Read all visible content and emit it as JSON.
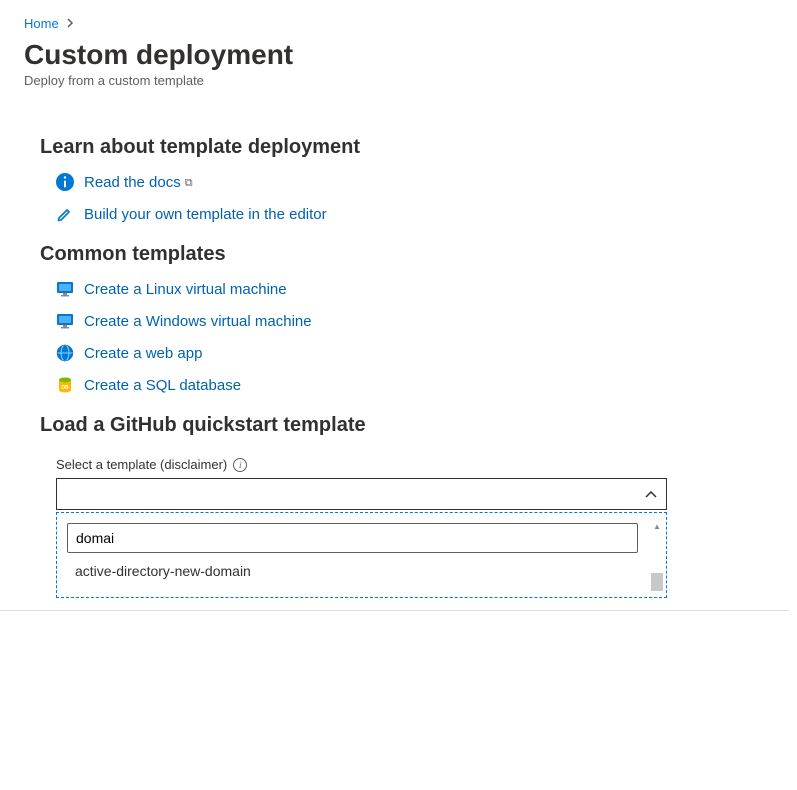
{
  "breadcrumb": {
    "home": "Home"
  },
  "header": {
    "title": "Custom deployment",
    "subtitle": "Deploy from a custom template"
  },
  "learn": {
    "heading": "Learn about template deployment",
    "docs_label": "Read the docs",
    "build_label": "Build your own template in the editor"
  },
  "common": {
    "heading": "Common templates",
    "items": [
      {
        "label": "Create a Linux virtual machine"
      },
      {
        "label": "Create a Windows virtual machine"
      },
      {
        "label": "Create a web app"
      },
      {
        "label": "Create a SQL database"
      }
    ]
  },
  "github": {
    "heading": "Load a GitHub quickstart template",
    "field_label": "Select a template (disclaimer)",
    "select_value": "",
    "search_value": "domai",
    "option": "active-directory-new-domain"
  }
}
